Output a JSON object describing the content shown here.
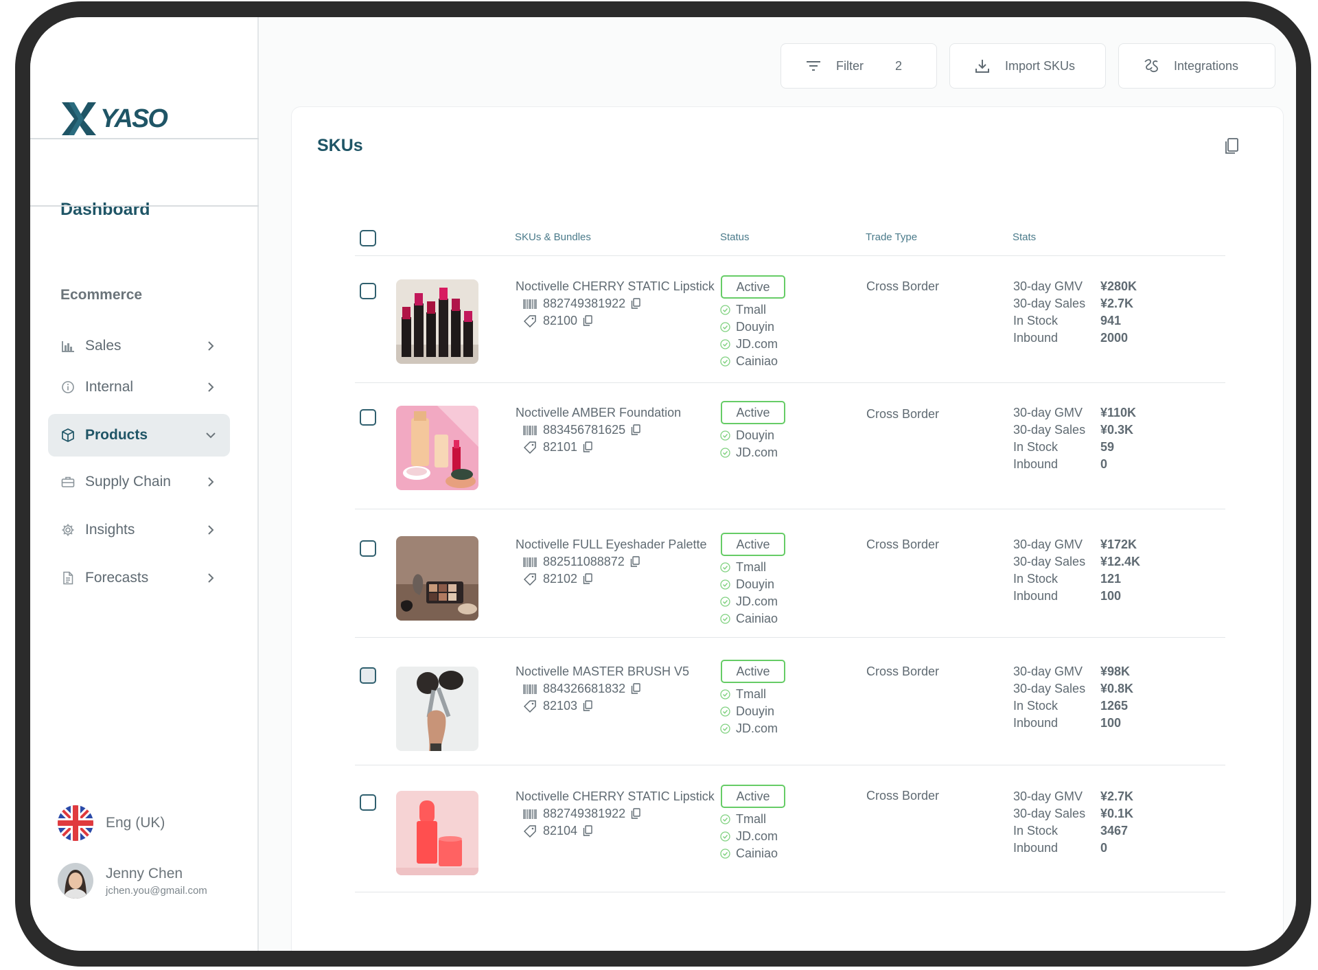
{
  "brand": {
    "name": "YASO",
    "color": "#1f5566"
  },
  "sidebar": {
    "dashboard_label": "Dashboard",
    "section_label": "Ecommerce",
    "items": [
      {
        "label": "Sales",
        "icon": "bar-chart-icon",
        "state": "collapsed"
      },
      {
        "label": "Internal",
        "icon": "info-icon",
        "state": "collapsed"
      },
      {
        "label": "Products",
        "icon": "box-icon",
        "state": "expanded",
        "active": true
      },
      {
        "label": "Supply Chain",
        "icon": "briefcase-icon",
        "state": "collapsed"
      },
      {
        "label": "Insights",
        "icon": "gear-icon",
        "state": "collapsed"
      },
      {
        "label": "Forecasts",
        "icon": "document-icon",
        "state": "collapsed"
      }
    ],
    "language": {
      "label": "Eng (UK)",
      "icon": "uk-flag-icon"
    },
    "user": {
      "name": "Jenny Chen",
      "email": "jchen.you@gmail.com"
    }
  },
  "toolbar": {
    "filter_label": "Filter",
    "filter_count": "2",
    "import_label": "Import SKUs",
    "integrations_label": "Integrations"
  },
  "skus_card": {
    "title": "SKUs",
    "columns": [
      "SKUs & Bundles",
      "Status",
      "Trade Type",
      "Stats"
    ],
    "stat_labels": [
      "30-day GMV",
      "30-day Sales",
      "In Stock",
      "Inbound"
    ],
    "rows": [
      {
        "name": "Noctivelle CHERRY STATIC Lipstick",
        "barcode": "882749381922",
        "tag": "82100",
        "status": "Active",
        "channels": [
          "Tmall",
          "Douyin",
          "JD.com",
          "Cainiao"
        ],
        "trade_type": "Cross Border",
        "stats": [
          "¥280K",
          "¥2.7K",
          "941",
          "2000"
        ]
      },
      {
        "name": "Noctivelle AMBER Foundation",
        "barcode": "883456781625",
        "tag": "82101",
        "status": "Active",
        "channels": [
          "Douyin",
          "JD.com"
        ],
        "trade_type": "Cross Border",
        "stats": [
          "¥110K",
          "¥0.3K",
          "59",
          "0"
        ]
      },
      {
        "name": "Noctivelle FULL Eyeshader Palette",
        "barcode": "882511088872",
        "tag": "82102",
        "status": "Active",
        "channels": [
          "Tmall",
          "Douyin",
          "JD.com",
          "Cainiao"
        ],
        "trade_type": "Cross Border",
        "stats": [
          "¥172K",
          "¥12.4K",
          "121",
          "100"
        ]
      },
      {
        "name": "Noctivelle MASTER BRUSH V5",
        "barcode": "884326681832",
        "tag": "82103",
        "status": "Active",
        "channels": [
          "Tmall",
          "Douyin",
          "JD.com"
        ],
        "trade_type": "Cross Border",
        "stats": [
          "¥98K",
          "¥0.8K",
          "1265",
          "100"
        ]
      },
      {
        "name": "Noctivelle CHERRY STATIC Lipstick",
        "barcode": "882749381922",
        "tag": "82104",
        "status": "Active",
        "channels": [
          "Tmall",
          "JD.com",
          "Cainiao"
        ],
        "trade_type": "Cross Border",
        "stats": [
          "¥2.7K",
          "¥0.1K",
          "3467",
          "0"
        ]
      }
    ]
  },
  "colors": {
    "status_border": "#66cc66",
    "channel_check": "#7fd17f",
    "active_nav_bg": "#e8ecee"
  }
}
